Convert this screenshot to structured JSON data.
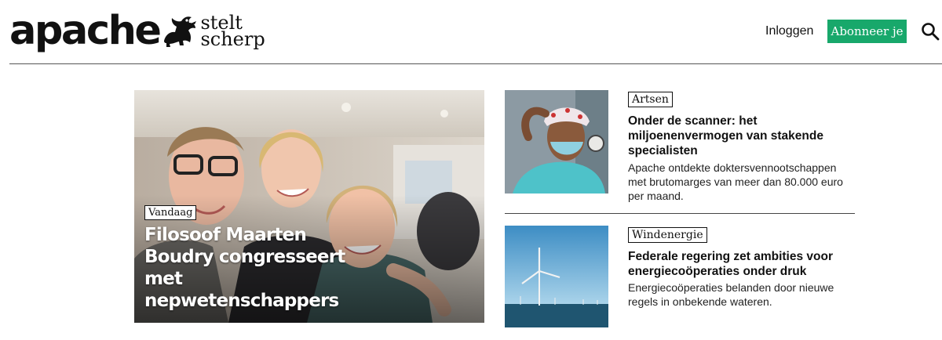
{
  "header": {
    "logo_word": "apache",
    "logo_tagline": [
      "stelt",
      "scherp"
    ],
    "login_label": "Inloggen",
    "subscribe_label": "Abonneer je",
    "search_icon": "search-icon",
    "subscribe_color": "#18a86b"
  },
  "hero": {
    "badge": "Vandaag",
    "title": "Filosoof Maarten Boudry congresseert met nepwetenschappers"
  },
  "articles": [
    {
      "tag": "Artsen",
      "title": "Onder de scanner: het miljoenenvermogen van stakende specialisten",
      "description": "Apache ontdekte doktersvennootschappen met brutomarges van meer dan 80.000 euro per maand."
    },
    {
      "tag": "Windenergie",
      "title": "Federale regering zet ambities voor energiecoöperaties onder druk",
      "description": "Energiecoöperaties belanden door nieuwe regels in onbekende wateren."
    }
  ]
}
